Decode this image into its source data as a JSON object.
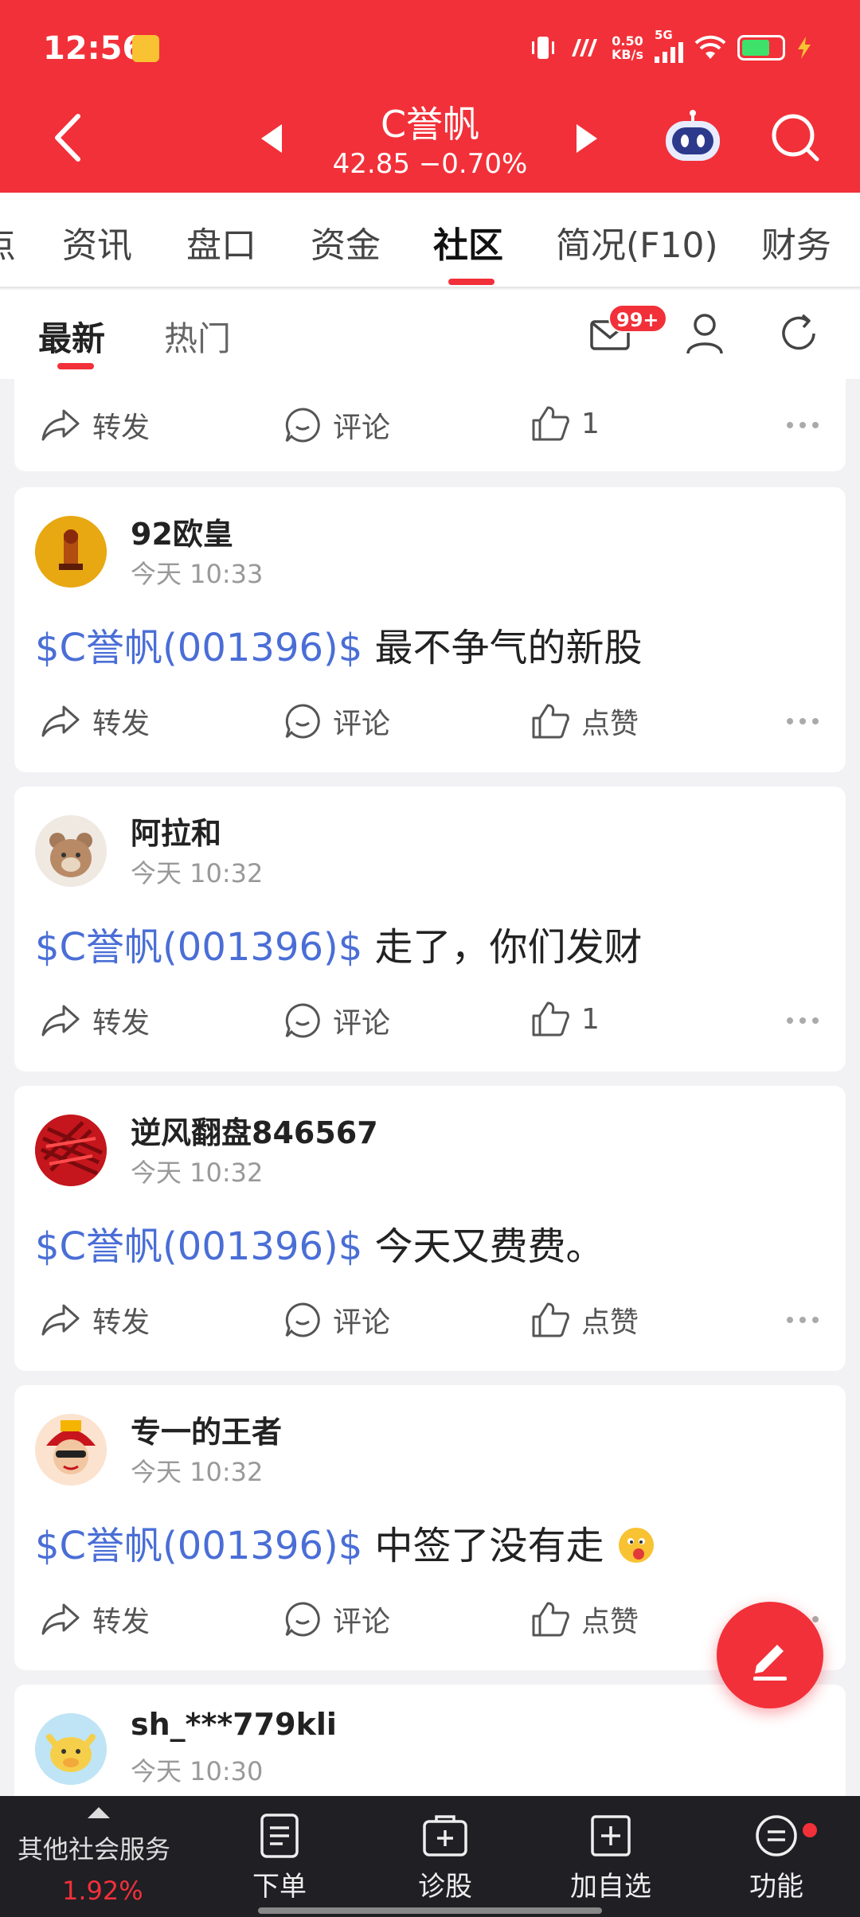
{
  "status_bar": {
    "time": "12:56",
    "net_speed_value": "0.50",
    "net_speed_unit": "KB/s",
    "network_type": "5G"
  },
  "header": {
    "stock_name": "C誉帆",
    "stock_price": "42.85 −0.70%"
  },
  "tabs": [
    {
      "label": "资讯"
    },
    {
      "label": "盘口"
    },
    {
      "label": "资金"
    },
    {
      "label": "社区"
    },
    {
      "label": "简况(F10)"
    },
    {
      "label": "财务"
    }
  ],
  "tabs_cutoff": "点",
  "subtabs": {
    "latest": "最新",
    "hot": "热门",
    "msg_badge": "99+"
  },
  "action_labels": {
    "forward": "转发",
    "comment": "评论",
    "like": "点赞"
  },
  "posts": [
    {
      "partial": true,
      "likes": "1"
    },
    {
      "user": "92欧皇",
      "time": "今天 10:33",
      "stock_tag": "$C誉帆(001396)$",
      "text": " 最不争气的新股",
      "likes": "点赞"
    },
    {
      "user": "阿拉和",
      "time": "今天 10:32",
      "stock_tag": "$C誉帆(001396)$",
      "text": " 走了，你们发财",
      "likes": "1"
    },
    {
      "user": "逆风翻盘846567",
      "time": "今天 10:32",
      "stock_tag": "$C誉帆(001396)$",
      "text": " 今天又费费。",
      "likes": "点赞"
    },
    {
      "user": "专一的王者",
      "time": "今天 10:32",
      "stock_tag": "$C誉帆(001396)$",
      "text": " 中签了没有走",
      "likes": "点赞"
    },
    {
      "user": "sh_***779kli",
      "time": "今天 10:30"
    }
  ],
  "bottom_nav": {
    "other_service": "其他社会服务",
    "other_service_pct": "1.92%",
    "items": [
      {
        "label": "下单"
      },
      {
        "label": "诊股"
      },
      {
        "label": "加自选"
      },
      {
        "label": "功能"
      }
    ]
  },
  "colors": {
    "brand_red": "#f23039",
    "link_blue": "#4a6ed6"
  }
}
